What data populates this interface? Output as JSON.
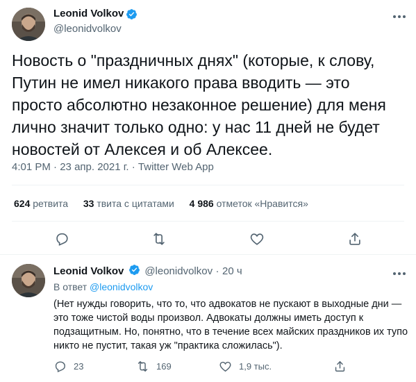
{
  "main_tweet": {
    "author_name": "Leonid Volkov",
    "author_handle": "@leonidvolkov",
    "text": "Новость о \"праздничных днях\" (которые, к слову, Путин не имел никакого права вводить — это просто абсолютно незаконное решение) для меня лично значит только одно: у нас 11 дней не будет новостей от Алексея и об Алексее.",
    "time": "4:01 PM",
    "date": "23 апр. 2021 г.",
    "source": "Twitter Web App",
    "separator": "·",
    "stats": {
      "retweets_num": "624",
      "retweets_label": "ретвита",
      "quotes_num": "33",
      "quotes_label": "твита с цитатами",
      "likes_num": "4 986",
      "likes_label": "отметок «Нравится»"
    }
  },
  "reply_tweet": {
    "author_name": "Leonid Volkov",
    "author_handle": "@leonidvolkov",
    "separator": "·",
    "time_ago": "20 ч",
    "reply_prefix": "В ответ",
    "reply_to": "@leonidvolkov",
    "text": "(Нет нужды говорить, что то, что адвокатов не пускают в выходные дни — это тоже чистой воды произвол. Адвокаты должны иметь доступ к подзащитным. Но, понятно, что в течение всех майских праздников их тупо никто не пустит, такая уж \"практика сложилась\").",
    "counts": {
      "replies": "23",
      "retweets": "169",
      "likes": "1,9 тыс."
    }
  },
  "icons": {
    "verified": "verified-badge-icon",
    "more": "more-dots-icon",
    "reply": "reply-icon",
    "retweet": "retweet-icon",
    "like": "like-icon",
    "share": "share-icon"
  },
  "colors": {
    "accent": "#1d9bf0",
    "text": "#0f1419",
    "secondary": "#536471",
    "divider": "#eff3f4"
  }
}
